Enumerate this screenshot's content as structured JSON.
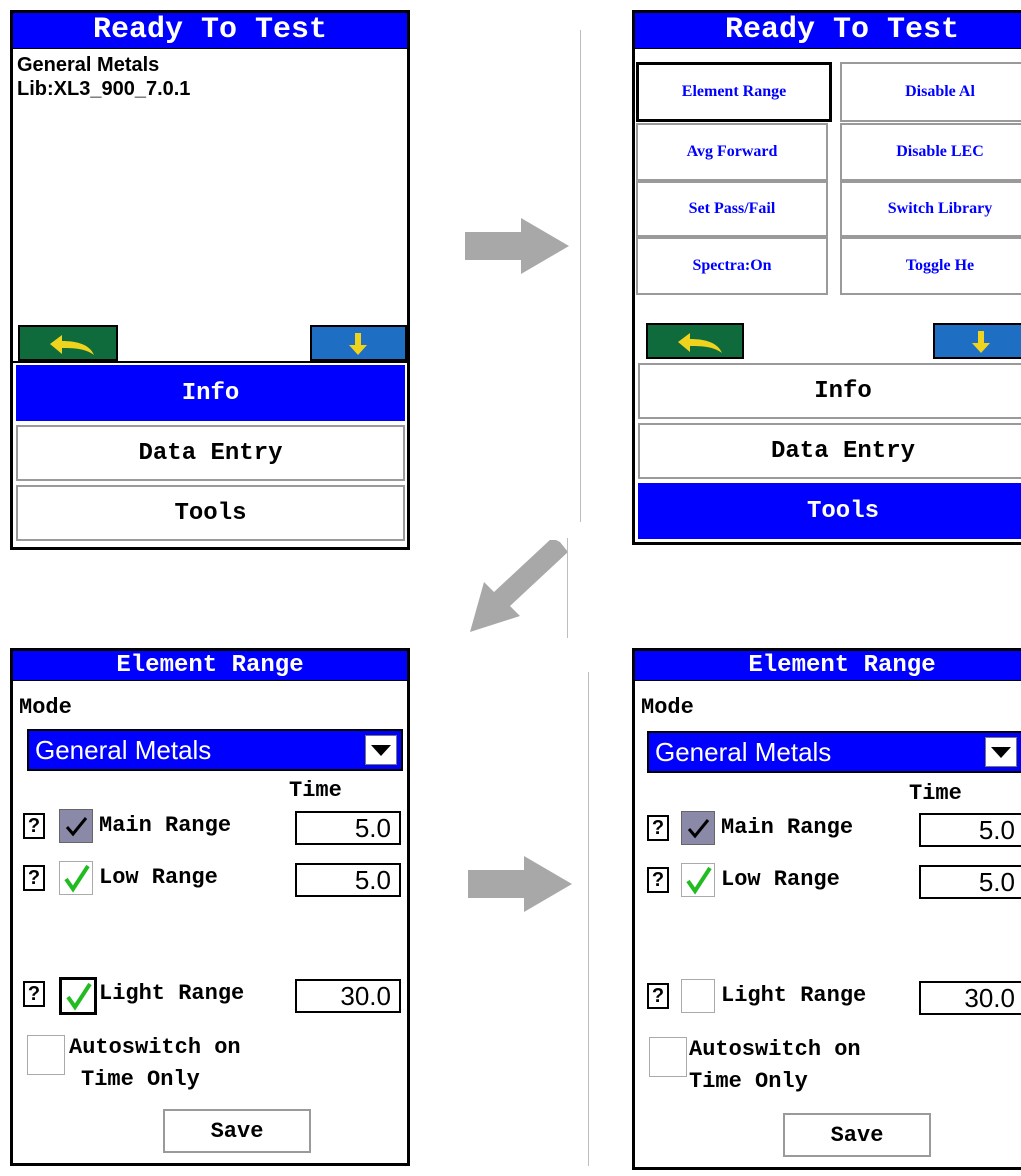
{
  "screen_ready": {
    "title": "Ready To Test",
    "mode_line": "General Metals",
    "library_line": "Lib:XL3_900_7.0.1",
    "menu": [
      "Info",
      "Data Entry",
      "Tools"
    ],
    "active_menu": "Info"
  },
  "screen_tools": {
    "title": "Ready To Test",
    "tiles": [
      "Element Range",
      "Disable Al",
      "Avg Forward",
      "Disable LEC",
      "Set Pass/Fail",
      "Switch Library",
      "Spectra:On",
      "Toggle He"
    ],
    "selected_tile": "Element Range",
    "menu": [
      "Info",
      "Data Entry",
      "Tools"
    ],
    "active_menu": "Tools"
  },
  "screen_range_a": {
    "title": "Element Range",
    "mode_label": "Mode",
    "mode_value": "General Metals",
    "time_header": "Time",
    "ranges": [
      {
        "help": "?",
        "label": "Main Range",
        "time": "5.0",
        "checked": true
      },
      {
        "help": "?",
        "label": "Low Range",
        "time": "5.0",
        "checked": true
      },
      {
        "help": "?",
        "label": "Light Range",
        "time": "30.0",
        "checked": true
      }
    ],
    "autoswitch_line1": "Autoswitch on",
    "autoswitch_line2": "Time Only",
    "save_label": "Save"
  },
  "screen_range_b": {
    "title": "Element Range",
    "mode_label": "Mode",
    "mode_value": "General Metals",
    "time_header": "Time",
    "ranges": [
      {
        "help": "?",
        "label": "Main Range",
        "time": "5.0",
        "checked": true
      },
      {
        "help": "?",
        "label": "Low Range",
        "time": "5.0",
        "checked": true
      },
      {
        "help": "?",
        "label": "Light Range",
        "time": "30.0",
        "checked": false
      }
    ],
    "autoswitch_line1": "Autoswitch on",
    "autoswitch_line2": "Time Only",
    "save_label": "Save"
  },
  "colors": {
    "title_bar": "#0000ff",
    "back_button": "#0f6b3c",
    "down_button": "#1e6fc4",
    "transition_arrow": "#a8a8a8",
    "check_green": "#22bb22"
  },
  "icons": [
    "back-arrow-icon",
    "down-arrow-icon",
    "dropdown-caret-icon",
    "checkmark-icon",
    "transition-arrow-icon"
  ]
}
